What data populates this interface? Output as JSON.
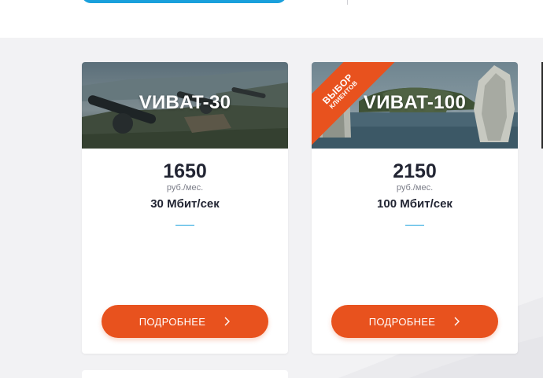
{
  "plans": [
    {
      "title": "VИBAT-30",
      "price": "1650",
      "price_unit": "руб./мес.",
      "speed": "30 Мбит/сек",
      "button_label": "ПОДРОБНЕЕ",
      "image": "cannons-on-hill-photo"
    },
    {
      "title": "VИBAT-100",
      "price": "2150",
      "price_unit": "руб./мес.",
      "speed": "100 Мбит/сек",
      "button_label": "ПОДРОБНЕЕ",
      "image": "sea-cliffs-photo",
      "badge": {
        "line1": "ВЫБОР",
        "line2": "КЛИЕНТОВ"
      }
    }
  ],
  "colors": {
    "accent": "#e8521e",
    "blue": "#1aa0dc",
    "text": "#222533",
    "muted": "#7c7e89",
    "background": "#f2f2f4"
  },
  "icons": {
    "button_icon": "chevron-right-icon"
  }
}
